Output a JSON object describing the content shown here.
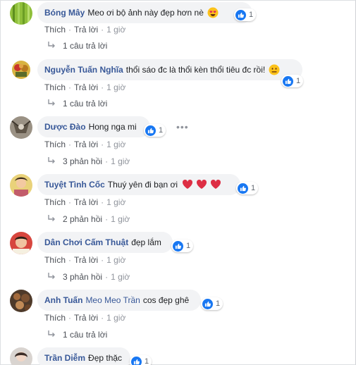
{
  "actions": {
    "like": "Thích",
    "reply": "Trả lời",
    "sep": "·"
  },
  "more_glyph": "•••",
  "comments": [
    {
      "author": "Bóng Mây",
      "mention": "",
      "text": "Meo ơi bộ ảnh này đẹp hơn nè",
      "emoji": "heart-eyes-face",
      "likes": "1",
      "time": "1 giờ",
      "replies": "1 câu trả lời",
      "reply_time": ""
    },
    {
      "author": "Nguyễn Tuấn Nghĩa",
      "mention": "",
      "text": "thổi sáo đc là thổi kèn thổi tiêu đc rồi!",
      "emoji": "neutral-face",
      "likes": "1",
      "time": "1 giờ",
      "replies": "1 câu trả lời",
      "reply_time": ""
    },
    {
      "author": "Dược Đào",
      "mention": "",
      "text": "Hong nga mi",
      "emoji": "",
      "likes": "1",
      "time": "1 giờ",
      "replies": "3 phản hồi",
      "reply_time": "1 giờ"
    },
    {
      "author": "Tuyệt Tình Cốc",
      "mention": "",
      "text": "Thuý yên đi bạn ơi",
      "emoji": "three-hearts",
      "likes": "1",
      "time": "1 giờ",
      "replies": "2 phản hồi",
      "reply_time": "1 giờ"
    },
    {
      "author": "Dân Chơi Cấm Thuật",
      "mention": "",
      "text": "đẹp lắm",
      "emoji": "",
      "likes": "1",
      "time": "1 giờ",
      "replies": "3 phản hồi",
      "reply_time": "1 giờ"
    },
    {
      "author": "Anh Tuấn",
      "mention": "Meo Meo Trần",
      "text": "cos đẹp ghê",
      "emoji": "",
      "likes": "1",
      "time": "1 giờ",
      "replies": "1 câu trả lời",
      "reply_time": ""
    },
    {
      "author": "Trần Diễm",
      "mention": "",
      "text": "Đẹp thặc",
      "emoji": "",
      "likes": "1",
      "time": "",
      "replies": "",
      "reply_time": ""
    }
  ]
}
